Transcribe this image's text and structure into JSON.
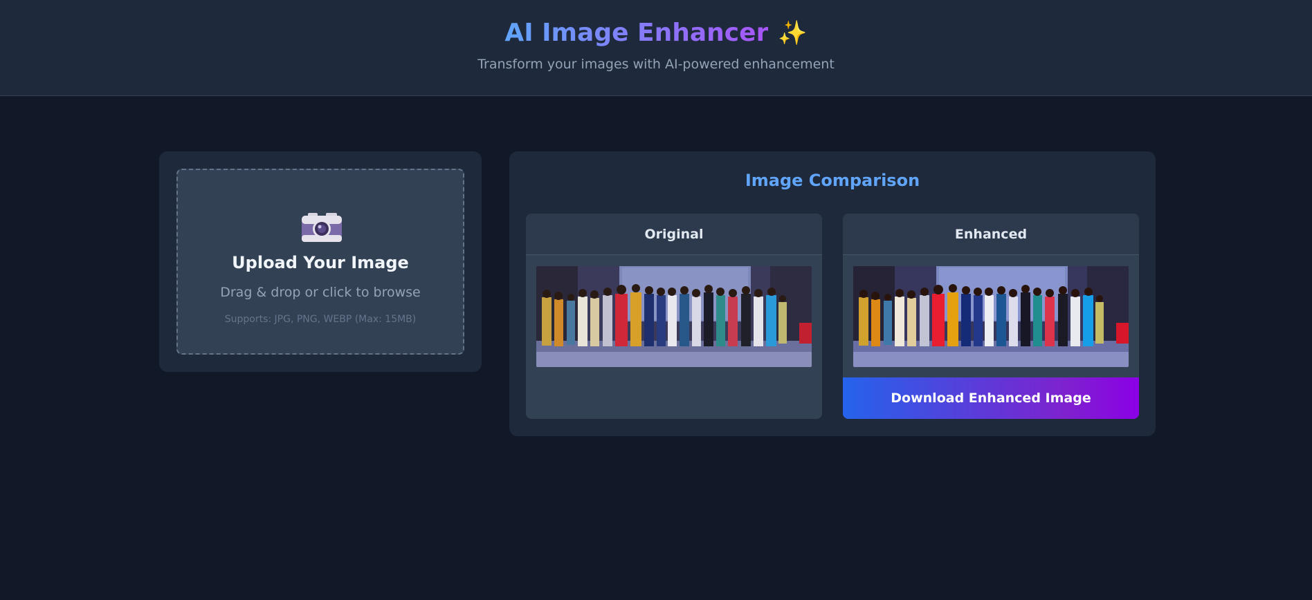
{
  "header": {
    "title": "AI Image Enhancer",
    "sparkle": "✨",
    "subtitle": "Transform your images with AI-powered enhancement"
  },
  "upload": {
    "icon": "camera-icon",
    "title": "Upload Your Image",
    "subtitle": "Drag & drop or click to browse",
    "note": "Supports: JPG, PNG, WEBP (Max: 15MB)"
  },
  "comparison": {
    "title": "Image Comparison",
    "original_label": "Original",
    "enhanced_label": "Enhanced",
    "download_label": "Download Enhanced Image"
  },
  "colors": {
    "background": "#111827",
    "card": "#1e293b",
    "accent": "#60a5fa",
    "gradient_start": "#2563eb",
    "gradient_end": "#8b00e6"
  }
}
